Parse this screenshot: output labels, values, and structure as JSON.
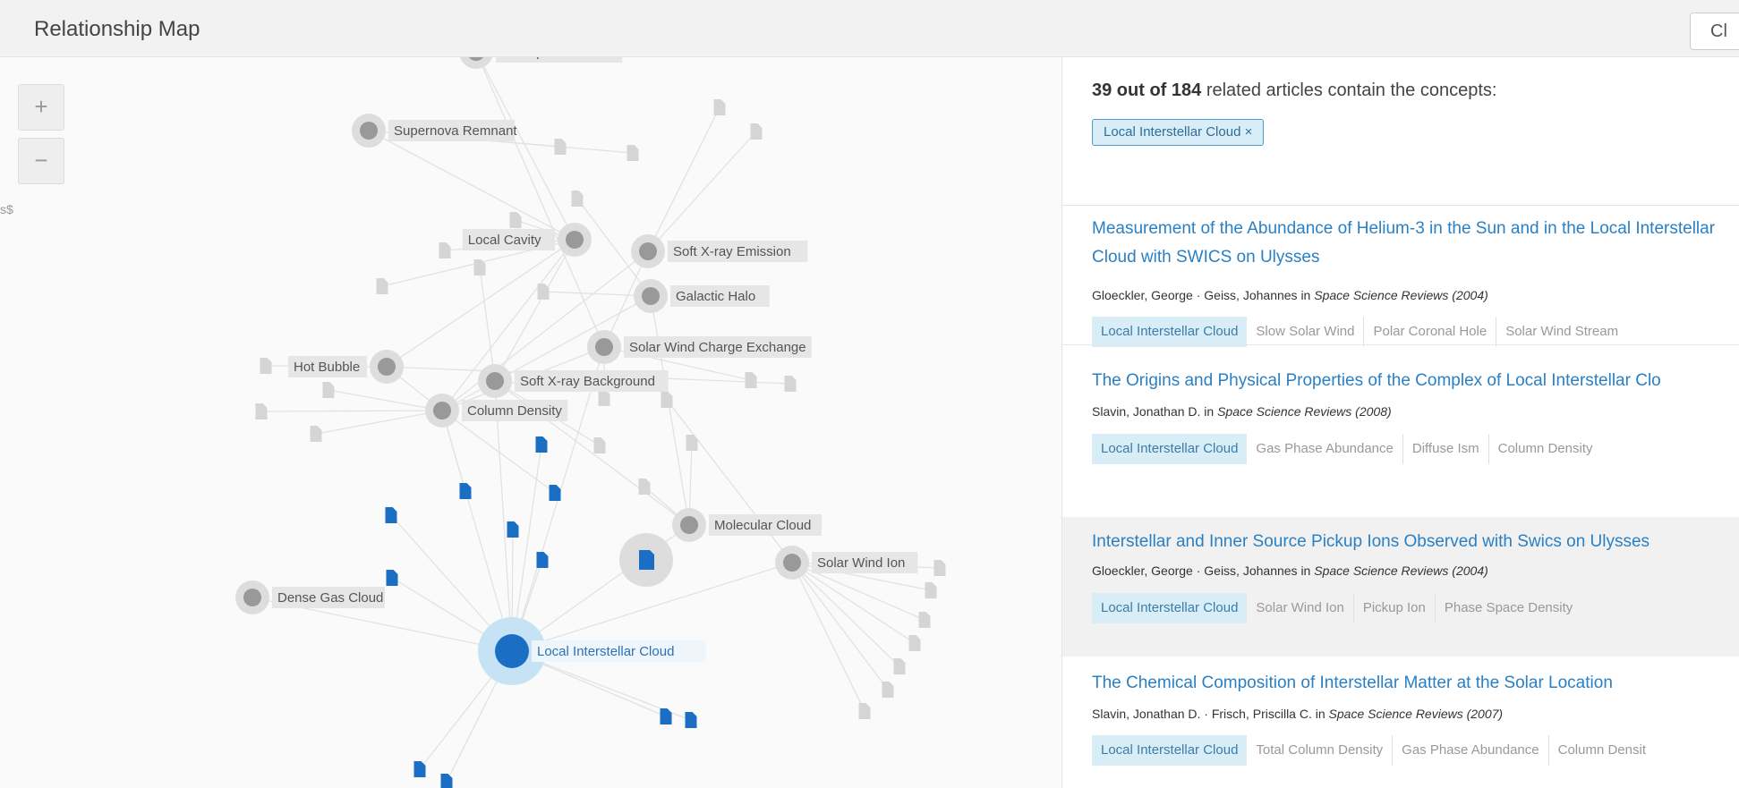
{
  "header": {
    "title": "Relationship Map",
    "close_label": "Cl"
  },
  "zoom": {
    "in_label": "+",
    "out_label": "−",
    "cut_label": "s$"
  },
  "graph": {
    "concepts": [
      {
        "label": "Absorption Column",
        "type": "concept"
      },
      {
        "label": "Supernova Remnant",
        "type": "concept"
      },
      {
        "label": "Local Cavity",
        "type": "concept"
      },
      {
        "label": "Soft X-ray Emission",
        "type": "concept"
      },
      {
        "label": "Galactic Halo",
        "type": "concept"
      },
      {
        "label": "Solar Wind Charge Exchange",
        "type": "concept"
      },
      {
        "label": "Hot Bubble",
        "type": "concept"
      },
      {
        "label": "Soft X-ray Background",
        "type": "concept"
      },
      {
        "label": "Column Density",
        "type": "concept"
      },
      {
        "label": "Molecular Cloud",
        "type": "concept"
      },
      {
        "label": "Solar Wind Ion",
        "type": "concept"
      },
      {
        "label": "Dense Gas Cloud",
        "type": "concept"
      },
      {
        "label": "Local Interstellar Cloud",
        "type": "selected"
      }
    ]
  },
  "panel": {
    "summary_count": "39 out of 184",
    "summary_text": " related articles contain the concepts:",
    "filter_chip": "Local Interstellar Cloud ×",
    "articles": [
      {
        "title": "Measurement of the Abundance of Helium-3 in the Sun and in the Local Interstellar Cloud with SWICS on Ulysses",
        "authors": "Gloeckler, George · Geiss, Johannes in ",
        "source": "Space Science Reviews (2004)",
        "tags": [
          "Local Interstellar Cloud",
          "Slow Solar Wind",
          "Polar Coronal Hole",
          "Solar Wind Stream"
        ]
      },
      {
        "title": "The Origins and Physical Properties of the Complex of Local Interstellar Clo",
        "authors": "Slavin, Jonathan D. in ",
        "source": "Space Science Reviews (2008)",
        "tags": [
          "Local Interstellar Cloud",
          "Gas Phase Abundance",
          "Diffuse Ism",
          "Column Density"
        ]
      },
      {
        "title": "Interstellar and Inner Source Pickup Ions Observed with Swics on Ulysses",
        "authors": "Gloeckler, George · Geiss, Johannes in ",
        "source": "Space Science Reviews (2004)",
        "tags": [
          "Local Interstellar Cloud",
          "Solar Wind Ion",
          "Pickup Ion",
          "Phase Space Density"
        ]
      },
      {
        "title": "The Chemical Composition of Interstellar Matter at the Solar Location",
        "authors": "Slavin, Jonathan D. · Frisch, Priscilla C. in ",
        "source": "Space Science Reviews (2007)",
        "tags": [
          "Local Interstellar Cloud",
          "Total Column Density",
          "Gas Phase Abundance",
          "Column Densit"
        ]
      }
    ]
  },
  "colors": {
    "accent": "#1a6fc4",
    "link": "#2a80c4",
    "chip_bg": "#d9edf7",
    "node_gray": "#999999",
    "halo_gray": "#dddddd",
    "doc_gray": "#d5d5d5"
  }
}
